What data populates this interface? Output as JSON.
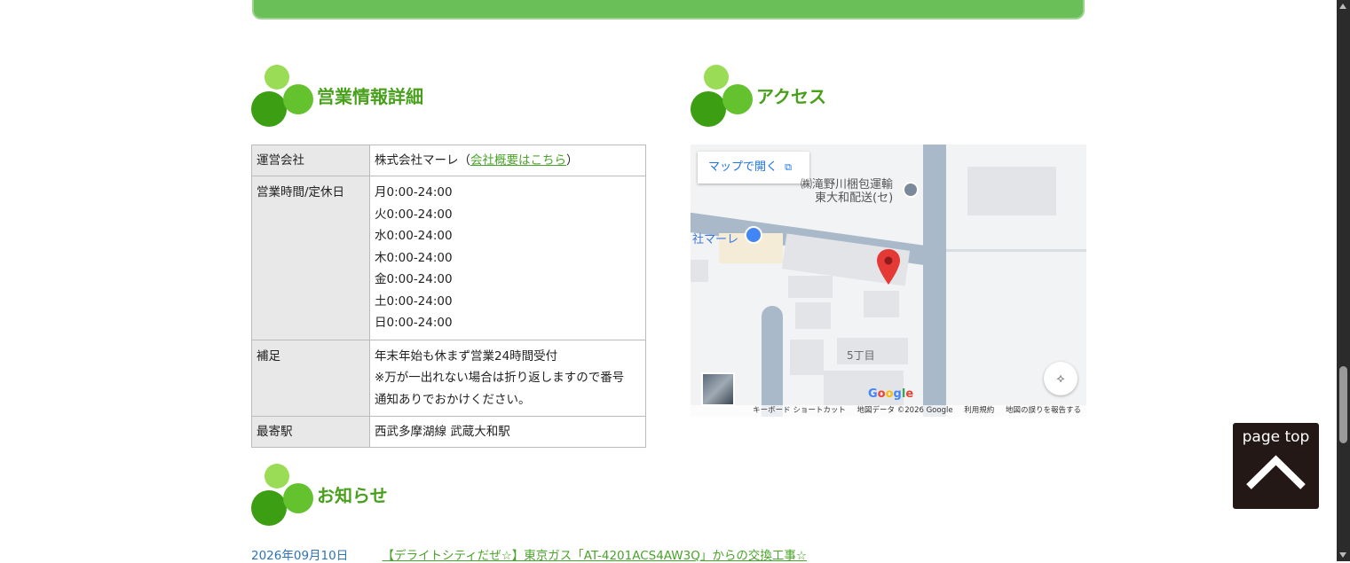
{
  "sections": {
    "business_info_title": "営業情報詳細",
    "access_title": "アクセス",
    "news_title": "お知らせ"
  },
  "info_table": {
    "company_label": "運営会社",
    "company_value": "株式会社マーレ（",
    "company_link": "会社概要はこちら",
    "company_value_end": "）",
    "hours_label": "営業時間/定休日",
    "hours": [
      "月0:00-24:00",
      "火0:00-24:00",
      "水0:00-24:00",
      "木0:00-24:00",
      "金0:00-24:00",
      "土0:00-24:00",
      "日0:00-24:00"
    ],
    "note_label": "補足",
    "note_lines": [
      "年末年始も休まず営業24時間受付",
      "※万が一出れない場合は折り返しますので番号",
      "通知ありでおかけください。"
    ],
    "station_label": "最寄駅",
    "station_value": "西武多摩湖線 武蔵大和駅"
  },
  "map": {
    "open_button": "マップで開く",
    "poi_line1": "㈱滝野川梱包運輸",
    "poi_line2": "東大和配送(セ)",
    "place_label": "社マーレ",
    "area_label": "5丁目",
    "google_logo": "Google",
    "attribution": {
      "shortcuts": "キーボード ショートカット",
      "map_data": "地図データ ©2026 Google",
      "terms": "利用規約",
      "report": "地図の誤りを報告する"
    }
  },
  "news": [
    {
      "date": "2026年09月10日",
      "title": "【デライトシティだぜ☆】東京ガス「AT-4201ACS4AW3Q」からの交換工事☆"
    }
  ],
  "page_top": {
    "label": "page top"
  },
  "colors": {
    "accent_green": "#49a01c",
    "link_green": "#4aa32a",
    "date_blue": "#2d73b8",
    "pagetop_bg": "#231815"
  }
}
